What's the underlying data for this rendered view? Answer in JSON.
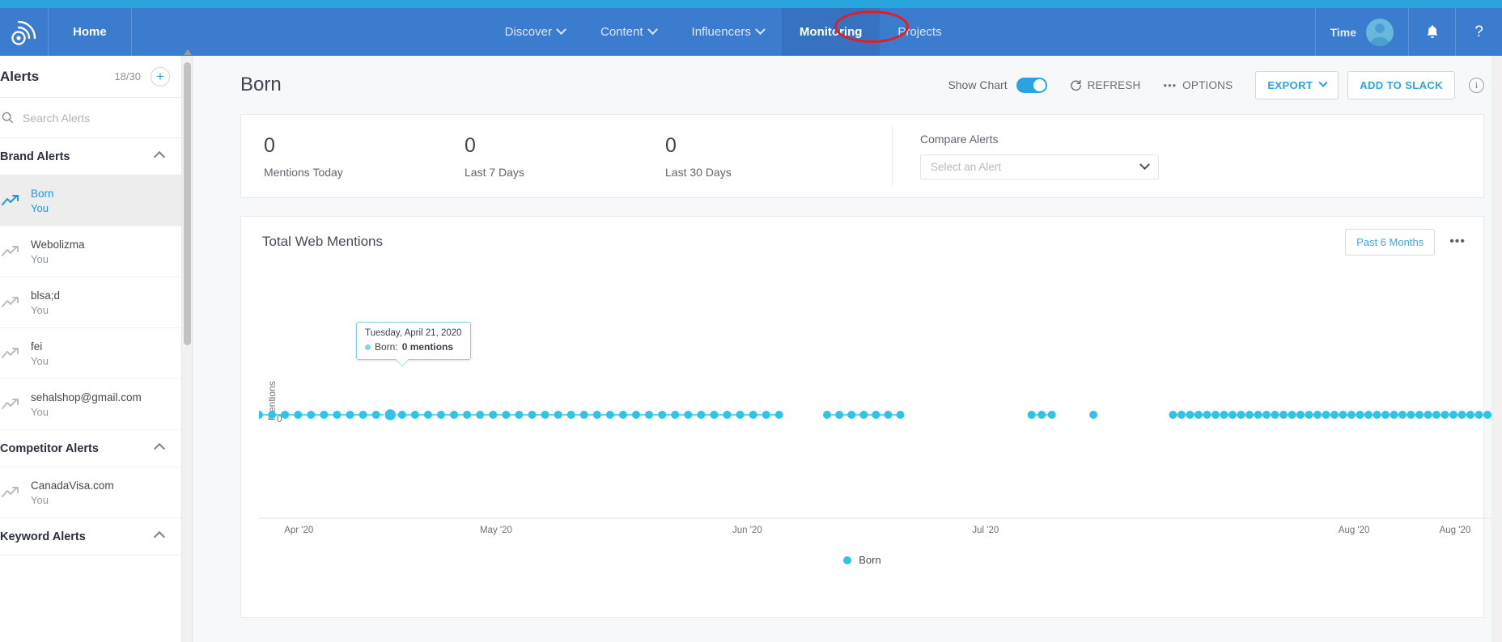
{
  "header": {
    "logo_icon": "signal-logo-icon",
    "home_label": "Home",
    "nav_items": [
      {
        "label": "Discover",
        "has_chevron": true,
        "active": false
      },
      {
        "label": "Content",
        "has_chevron": true,
        "active": false
      },
      {
        "label": "Influencers",
        "has_chevron": true,
        "active": false
      },
      {
        "label": "Monitoring",
        "has_chevron": false,
        "active": true
      },
      {
        "label": "Projects",
        "has_chevron": false,
        "active": false
      }
    ],
    "user_label": "Time",
    "bell_icon": "⌂",
    "help_icon": "?",
    "annotation_color": "#e81c1c"
  },
  "sidebar": {
    "title": "Alerts",
    "count": "18/30",
    "add_label": "+",
    "search_placeholder": "Search Alerts",
    "search_value": "",
    "groups": [
      {
        "label": "Brand Alerts",
        "items": [
          {
            "name": "Born",
            "sub": "You",
            "active": true
          },
          {
            "name": "Webolizma",
            "sub": "You",
            "active": false
          },
          {
            "name": "blsa;d",
            "sub": "You",
            "active": false
          },
          {
            "name": "fei",
            "sub": "You",
            "active": false
          },
          {
            "name": "sehalshop@gmail.com",
            "sub": "You",
            "active": false
          }
        ]
      },
      {
        "label": "Competitor Alerts",
        "items": [
          {
            "name": "CanadaVisa.com",
            "sub": "You",
            "active": false
          }
        ]
      },
      {
        "label": "Keyword Alerts",
        "items": []
      }
    ]
  },
  "main": {
    "page_title": "Born",
    "toolbar": {
      "show_chart_label": "Show Chart",
      "show_chart_on": true,
      "refresh_label": "REFRESH",
      "options_label": "OPTIONS",
      "export_label": "EXPORT",
      "add_to_slack_label": "ADD TO SLACK",
      "info_label": "i"
    },
    "stats": [
      {
        "value": "0",
        "label": "Mentions Today"
      },
      {
        "value": "0",
        "label": "Last 7 Days"
      },
      {
        "value": "0",
        "label": "Last 30 Days"
      }
    ],
    "compare": {
      "label": "Compare Alerts",
      "placeholder": "Select an Alert",
      "value": ""
    },
    "chart_card": {
      "title": "Total Web Mentions",
      "range_label": "Past 6 Months",
      "kebab_label": "•••"
    },
    "tooltip": {
      "date": "Tuesday, April 21, 2020",
      "series": "Born",
      "value": "0 mentions"
    }
  },
  "chart_data": {
    "type": "line",
    "title": "Total Web Mentions",
    "xlabel": "",
    "ylabel": "Mentions",
    "ylim": [
      0,
      1
    ],
    "yticks": [
      "0"
    ],
    "xticks": [
      "Apr '20",
      "May '20",
      "Jun '20",
      "Jul '20",
      "Aug '20",
      "Aug '20"
    ],
    "xtick_positions": [
      0.02,
      0.175,
      0.375,
      0.565,
      0.855,
      0.935
    ],
    "grid": false,
    "legend": {
      "position": "bottom",
      "entries": [
        "Born"
      ]
    },
    "series": [
      {
        "name": "Born",
        "color": "#2ec4e6",
        "marker": "circle",
        "values_all_zero": true,
        "segments": [
          {
            "start": 0.0,
            "end": 0.412,
            "points": 41
          },
          {
            "start": 0.45,
            "end": 0.508,
            "points": 7
          },
          {
            "start": 0.612,
            "end": 0.628,
            "points": 3
          },
          {
            "start": 0.661,
            "end": 0.661,
            "points": 1
          },
          {
            "start": 0.724,
            "end": 1.0,
            "points": 42
          }
        ]
      }
    ],
    "highlighted_point": {
      "x_fraction": 0.104,
      "date": "Tuesday, April 21, 2020",
      "value": 0
    }
  }
}
